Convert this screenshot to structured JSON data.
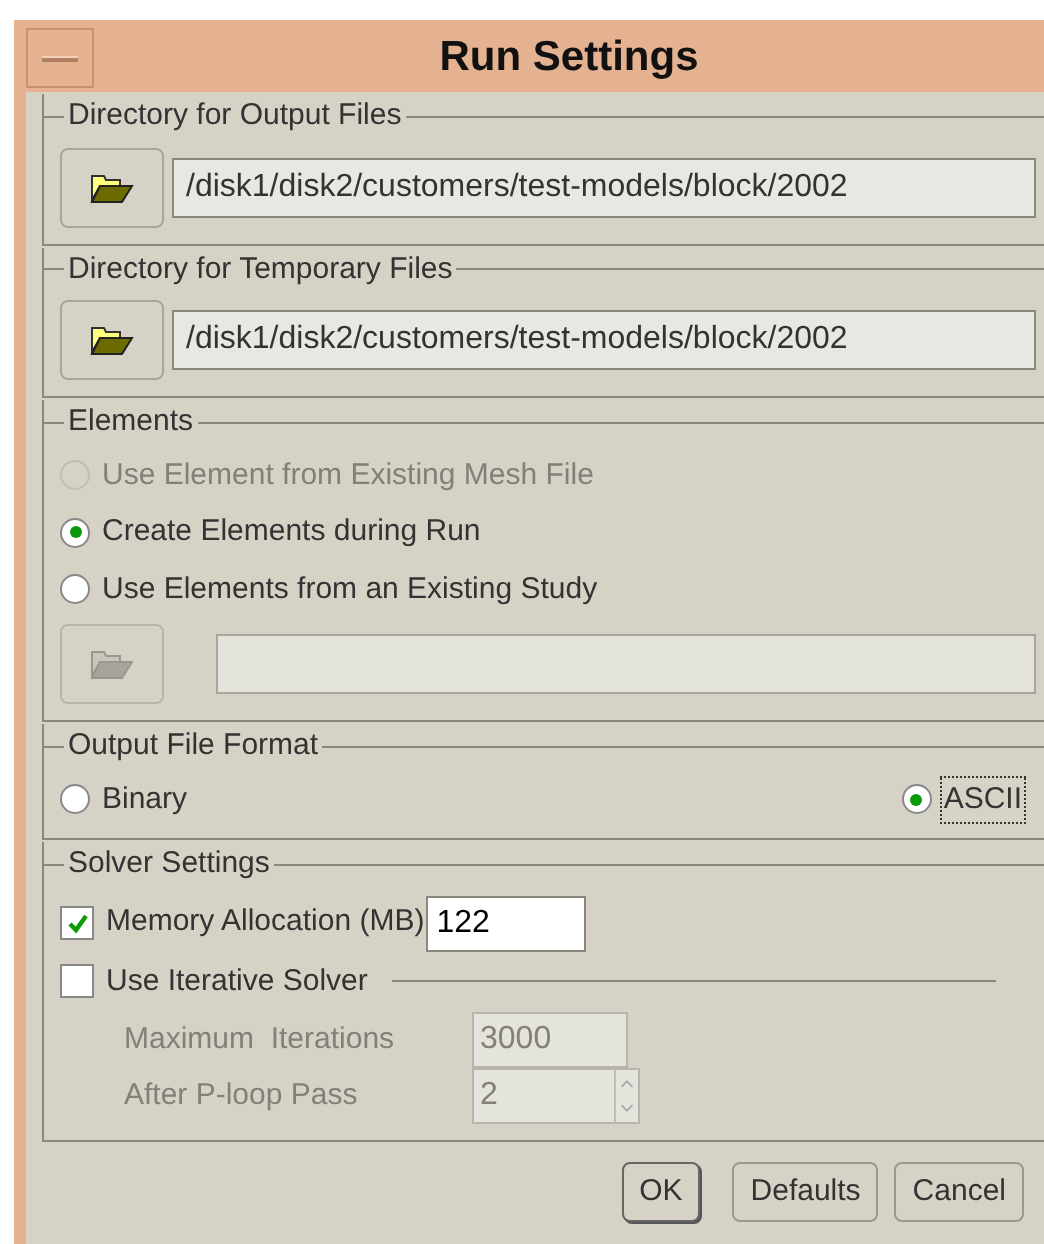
{
  "window": {
    "title": "Run Settings"
  },
  "output_dir": {
    "label": "Directory for Output Files",
    "value": "/disk1/disk2/customers/test-models/block/2002"
  },
  "temp_dir": {
    "label": "Directory for Temporary Files",
    "value": "/disk1/disk2/customers/test-models/block/2002"
  },
  "elements": {
    "label": "Elements",
    "options": [
      {
        "label": "Use Element from Existing Mesh File",
        "selected": false,
        "disabled": true
      },
      {
        "label": "Create Elements during Run",
        "selected": true,
        "disabled": false
      },
      {
        "label": "Use Elements from an Existing Study",
        "selected": false,
        "disabled": false
      }
    ],
    "browse": {
      "disabled": true
    }
  },
  "output_format": {
    "label": "Output File Format",
    "options": [
      {
        "label": "Binary",
        "selected": false,
        "focused": false
      },
      {
        "label": "ASCII",
        "selected": true,
        "focused": true
      }
    ]
  },
  "solver": {
    "label": "Solver Settings",
    "memory": {
      "label": "Memory Allocation (MB)",
      "checked": true,
      "value": "122"
    },
    "iterative": {
      "label": "Use Iterative Solver",
      "checked": false
    },
    "max_iterations": {
      "label": "Maximum  Iterations",
      "value": "3000",
      "disabled": true
    },
    "after_pass": {
      "label": "After P-loop Pass",
      "value": "2",
      "disabled": true
    }
  },
  "buttons": [
    {
      "label": "OK",
      "default": true
    },
    {
      "label": "Defaults",
      "default": false
    },
    {
      "label": "Cancel",
      "default": false
    }
  ]
}
